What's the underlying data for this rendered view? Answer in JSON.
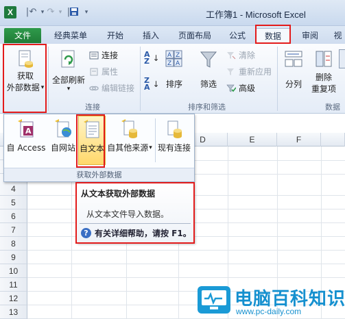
{
  "window": {
    "title": "工作簿1 - Microsoft Excel"
  },
  "tabs": [
    {
      "label": "文件"
    },
    {
      "label": "经典菜单"
    },
    {
      "label": "开始"
    },
    {
      "label": "插入"
    },
    {
      "label": "页面布局"
    },
    {
      "label": "公式"
    },
    {
      "label": "数据"
    },
    {
      "label": "审阅"
    },
    {
      "label": "视"
    }
  ],
  "ribbon": {
    "get_external_data": {
      "line1": "获取",
      "line2": "外部数据"
    },
    "connections_group": {
      "refresh_all": "全部刷新",
      "connections": "连接",
      "properties": "属性",
      "edit_links": "编辑链接",
      "label": "连接"
    },
    "sort_filter_group": {
      "sort": "排序",
      "filter": "筛选",
      "clear": "清除",
      "reapply": "重新应用",
      "advanced": "高级",
      "label": "排序和筛选"
    },
    "data_tools_group": {
      "split": "分列",
      "remove_dup_line1": "删除",
      "remove_dup_line2": "重复项",
      "label": "数据"
    }
  },
  "dropdown": {
    "items": [
      {
        "label": "自 Access"
      },
      {
        "label": "自网站"
      },
      {
        "label": "自文本"
      },
      {
        "label": "自其他来源"
      },
      {
        "label": "现有连接"
      }
    ],
    "footer": "获取外部数据"
  },
  "sheet": {
    "columns": [
      "D",
      "E",
      "F"
    ],
    "rows": [
      "4",
      "5",
      "6",
      "7",
      "8",
      "9",
      "10",
      "11",
      "12",
      "13",
      "14"
    ]
  },
  "tooltip": {
    "title": "从文本获取外部数据",
    "description": "从文本文件导入数据。",
    "help": "有关详细帮助，请按 F1。"
  },
  "watermark": {
    "title": "电脑百科知识",
    "url": "www.pc-daily.com"
  },
  "colors": {
    "file_tab": "#1f7c37",
    "highlight_box": "#e31a1a",
    "hover_item": "#ffd86b",
    "watermark": "#1590cf"
  }
}
